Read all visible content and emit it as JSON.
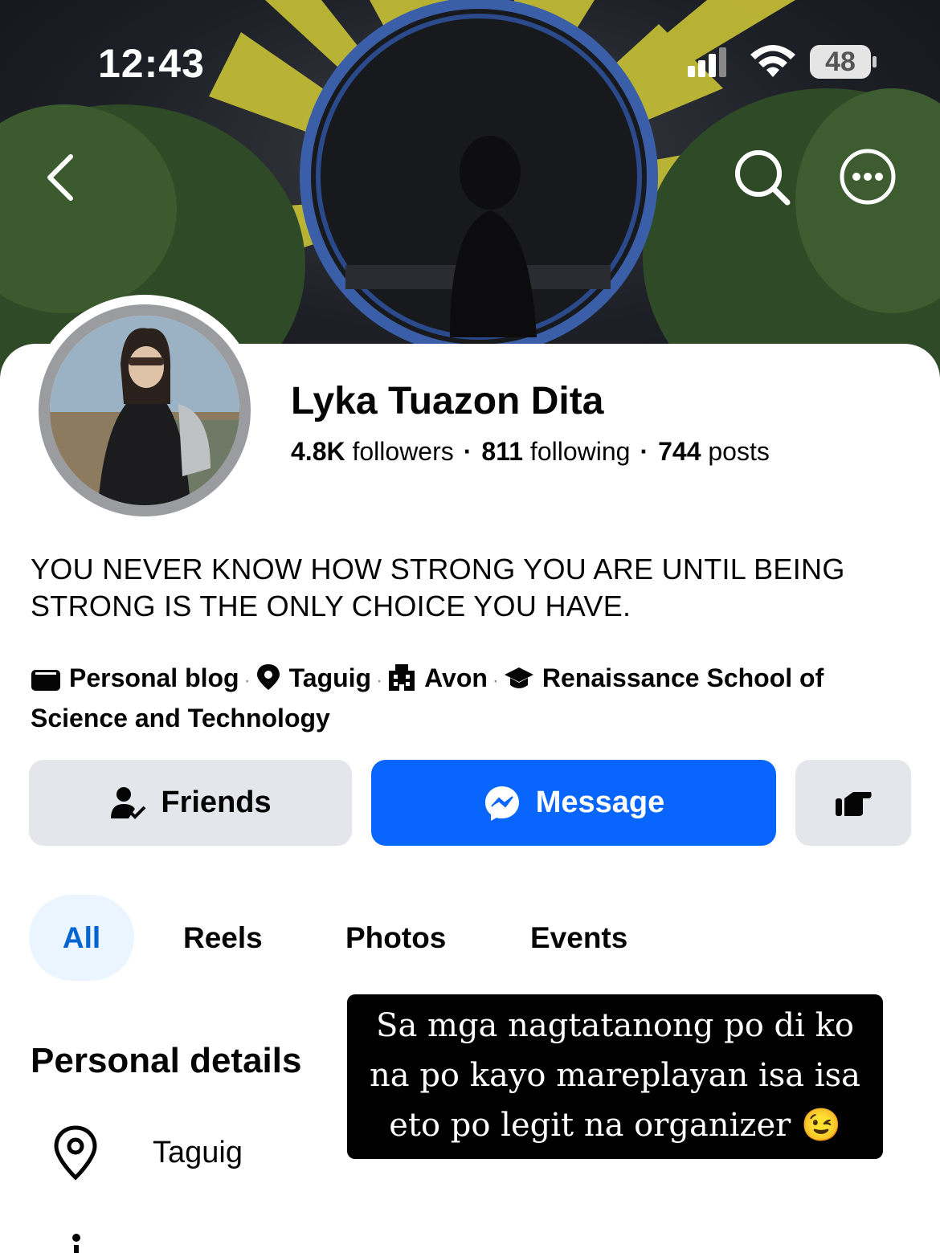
{
  "status_bar": {
    "time": "12:43",
    "battery": "48"
  },
  "profile": {
    "name": "Lyka Tuazon Dita",
    "followers_count": "4.8K",
    "followers_label": "followers",
    "following_count": "811",
    "following_label": "following",
    "posts_count": "744",
    "posts_label": "posts",
    "bio_line1": "YOU NEVER KNOW HOW STRONG YOU ARE UNTIL BEING",
    "bio_line2": "STRONG IS THE ONLY CHOICE YOU HAVE.",
    "details": {
      "category": "Personal blog",
      "location": "Taguig",
      "work": "Avon",
      "school_part1": "Renaissance School of",
      "school_part2": "Science and Technology"
    }
  },
  "actions": {
    "friends_label": "Friends",
    "message_label": "Message"
  },
  "tabs": [
    {
      "label": "All",
      "active": true
    },
    {
      "label": "Reels"
    },
    {
      "label": "Photos"
    },
    {
      "label": "Events"
    }
  ],
  "personal_details": {
    "title": "Personal details",
    "location": "Taguig"
  },
  "overlay_caption": {
    "line1": "Sa mga nagtatanong po di ko",
    "line2": "na po kayo mareplayan isa isa",
    "line3": "eto po legit na organizer 😉"
  },
  "colors": {
    "accent": "#0866ff",
    "active_tab_bg": "#ebf5ff",
    "button_bg": "#e4e6eb"
  },
  "icons": [
    "back-icon",
    "search-icon",
    "more-icon",
    "friends-icon",
    "messenger-icon",
    "poke-icon",
    "location-icon",
    "work-icon",
    "school-icon",
    "category-icon"
  ]
}
